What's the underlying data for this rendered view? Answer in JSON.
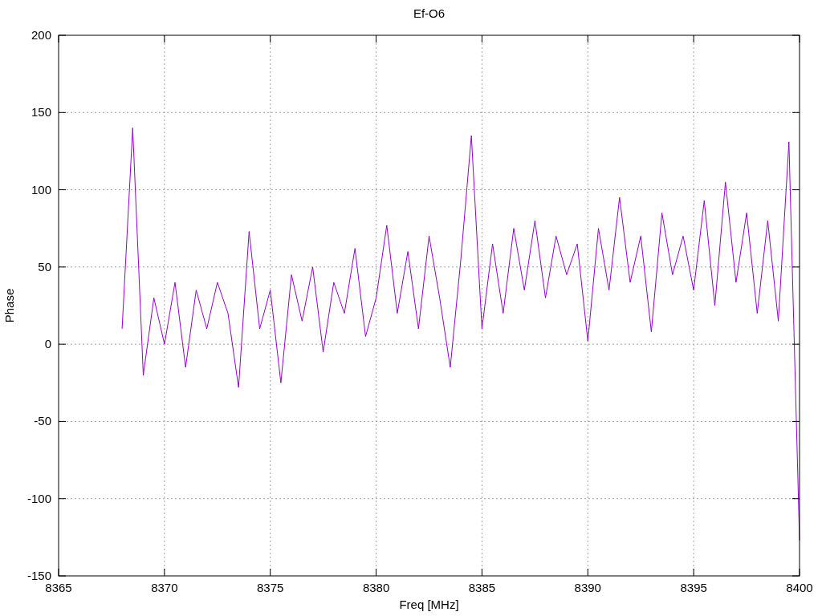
{
  "chart": {
    "chart_data": {
      "type": "line",
      "grid": true,
      "title": "Ef-O6",
      "xlabel": "Freq [MHz]",
      "ylabel": "Phase",
      "xlim": [
        8365,
        8400
      ],
      "ylim": [
        -150,
        200
      ],
      "xticks": [
        8365,
        8370,
        8375,
        8380,
        8385,
        8390,
        8395,
        8400
      ],
      "yticks": [
        -150,
        -100,
        -50,
        0,
        50,
        100,
        150,
        200
      ],
      "x": [
        8368,
        8368.5,
        8369,
        8369.5,
        8370,
        8370.5,
        8371,
        8371.5,
        8372,
        8372.5,
        8373,
        8373.5,
        8374,
        8374.5,
        8375,
        8375.5,
        8376,
        8376.5,
        8377,
        8377.5,
        8378,
        8378.5,
        8379,
        8379.5,
        8380,
        8380.5,
        8381,
        8381.5,
        8382,
        8382.5,
        8383,
        8383.5,
        8384,
        8384.5,
        8385,
        8385.5,
        8386,
        8386.5,
        8387,
        8387.5,
        8388,
        8388.5,
        8389,
        8389.5,
        8390,
        8390.5,
        8391,
        8391.5,
        8392,
        8392.5,
        8393,
        8393.5,
        8394,
        8394.5,
        8395,
        8395.5,
        8396,
        8396.5,
        8397,
        8397.5,
        8398,
        8398.5,
        8399,
        8399.5,
        8400
      ],
      "series": [
        {
          "color": "#9400d3",
          "values": [
            10,
            140,
            -20,
            30,
            0,
            40,
            -15,
            35,
            10,
            40,
            20,
            -28,
            73,
            10,
            35,
            -25,
            45,
            15,
            50,
            -5,
            40,
            20,
            62,
            5,
            30,
            77,
            20,
            60,
            10,
            70,
            30,
            -15,
            55,
            135,
            10,
            65,
            20,
            75,
            35,
            80,
            30,
            70,
            45,
            65,
            2,
            75,
            35,
            95,
            40,
            70,
            8,
            85,
            45,
            70,
            35,
            93,
            25,
            105,
            40,
            85,
            20,
            80,
            15,
            131,
            -127
          ]
        }
      ]
    }
  }
}
